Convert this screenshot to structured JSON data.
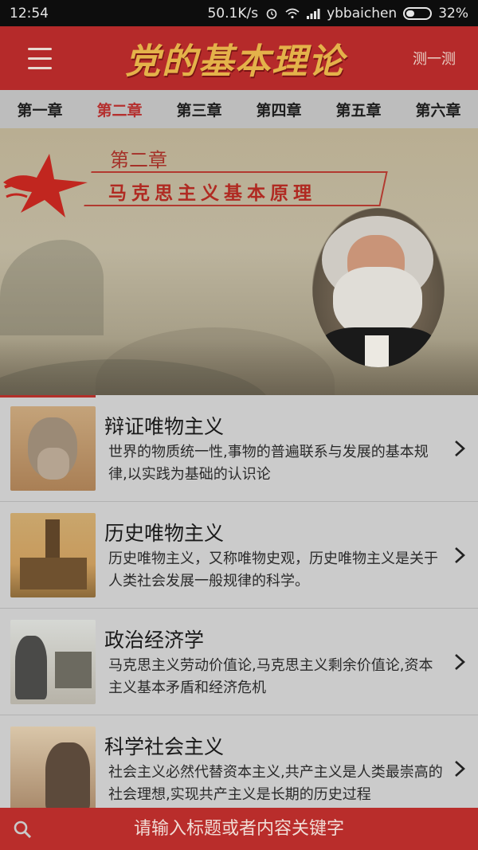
{
  "status": {
    "time": "12:54",
    "net_speed": "50.1K/s",
    "carrier": "ybbaichen",
    "battery": "32%"
  },
  "appbar": {
    "title": "党的基本理论",
    "quiz_label": "测一测"
  },
  "tabs": [
    {
      "label": "第一章",
      "active": false
    },
    {
      "label": "第二章",
      "active": true
    },
    {
      "label": "第三章",
      "active": false
    },
    {
      "label": "第四章",
      "active": false
    },
    {
      "label": "第五章",
      "active": false
    },
    {
      "label": "第六章",
      "active": false
    }
  ],
  "banner": {
    "chapter": "第二章",
    "chapter_title": "马克思主义基本原理"
  },
  "items": [
    {
      "title": "辩证唯物主义",
      "desc": "世界的物质统一性,事物的普遍联系与发展的基本规律,以实践为基础的认识论"
    },
    {
      "title": "历史唯物主义",
      "desc": "历史唯物主义，又称唯物史观，历史唯物主义是关于人类社会发展一般规律的科学。"
    },
    {
      "title": "政治经济学",
      "desc": "马克思主义劳动价值论,马克思主义剩余价值论,资本主义基本矛盾和经济危机"
    },
    {
      "title": "科学社会主义",
      "desc": "社会主义必然代替资本主义,共产主义是人类最崇高的社会理想,实现共产主义是长期的历史过程"
    }
  ],
  "search": {
    "placeholder": "请输入标题或者内容关键字"
  },
  "colors": {
    "brand_red": "#b52a2a",
    "active_tab": "#b4302f",
    "title_gold": "#e4b24a"
  },
  "icons": [
    "menu-icon",
    "search-icon",
    "chevron-right-icon",
    "alarm-icon",
    "wifi-icon",
    "signal-icon",
    "battery-icon"
  ]
}
